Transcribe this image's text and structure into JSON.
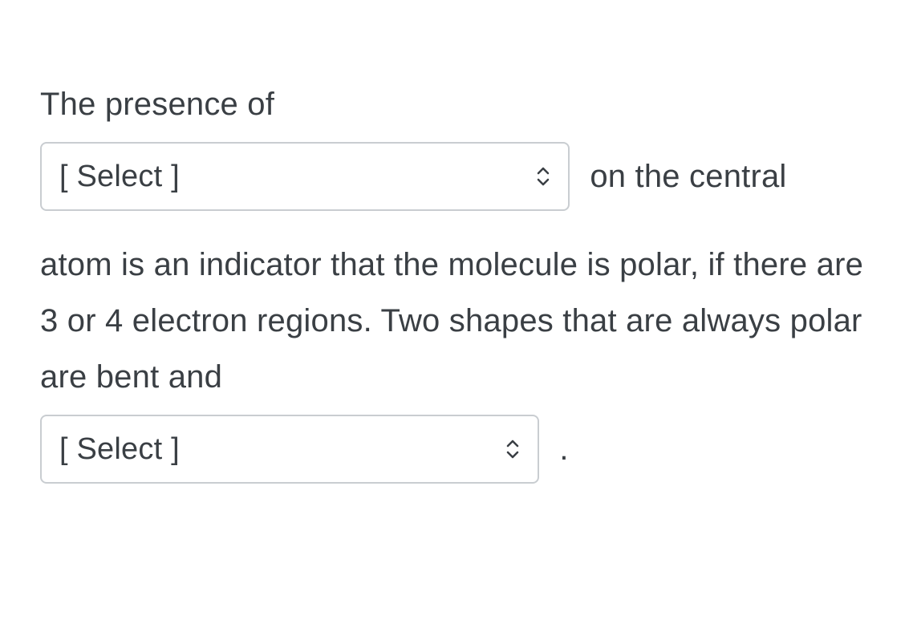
{
  "question": {
    "text_before_select1": "The presence of",
    "select1_placeholder": "[ Select ]",
    "text_after_select1": "on the central",
    "text_middle": "atom is an indicator that the molecule is polar, if there are 3 or 4 electron regions. Two shapes that are always polar are bent and",
    "select2_placeholder": "[ Select ]",
    "text_after_select2": "."
  }
}
